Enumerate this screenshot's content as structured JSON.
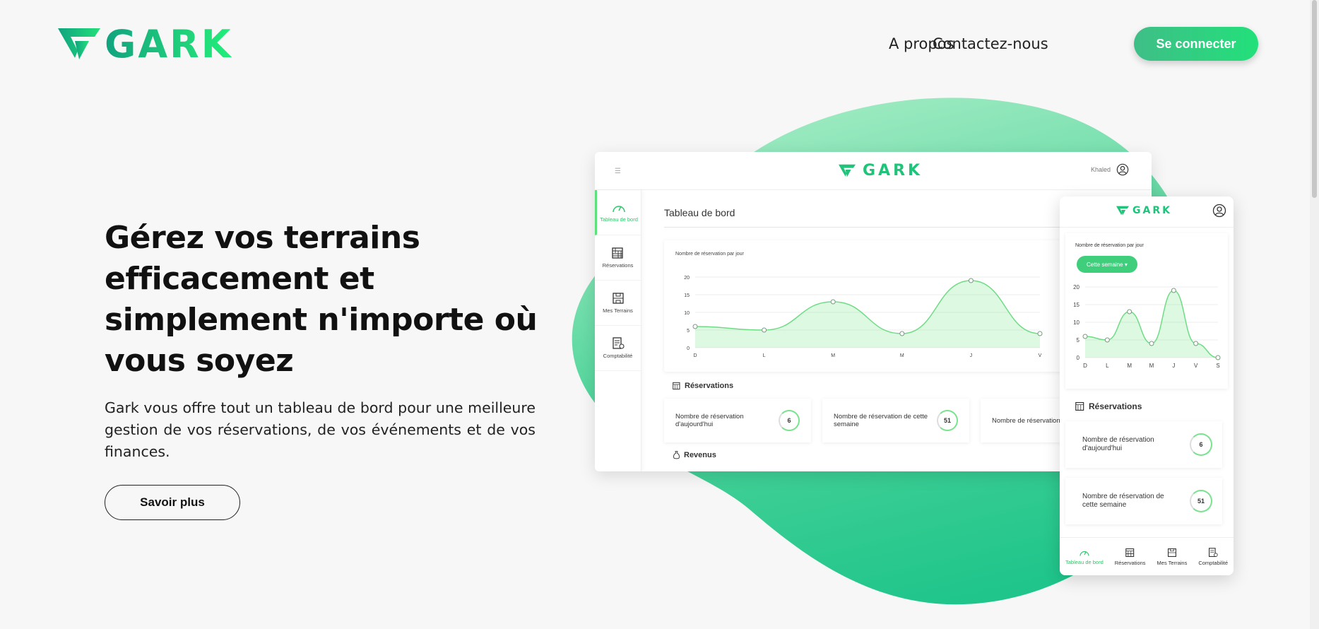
{
  "header": {
    "brand": "GARK",
    "nav": [
      {
        "label": "A propos"
      },
      {
        "label": "Contactez-nous"
      }
    ],
    "login_label": "Se connecter"
  },
  "hero": {
    "title": "Gérez vos terrains efficacement et simplement n'importe où vous soyez",
    "description": "Gark vous offre tout un tableau de bord pour une meilleure gestion de vos réservations, de vos événements et de vos finances.",
    "cta_label": "Savoir plus"
  },
  "desktop_mock": {
    "brand": "GARK",
    "user": "Khaled",
    "sidebar": [
      {
        "label": "Tableau de bord"
      },
      {
        "label": "Réservations"
      },
      {
        "label": "Mes Terrains"
      },
      {
        "label": "Comptabilité"
      }
    ],
    "page_title": "Tableau de bord",
    "chart_title": "Nombre de réservation par jour",
    "reservations_heading": "Réservations",
    "stats": [
      {
        "label": "Nombre de réservation d'aujourd'hui",
        "value": "6"
      },
      {
        "label": "Nombre de réservation de cette semaine",
        "value": "51"
      },
      {
        "label": "Nombre de réservation",
        "value": ""
      }
    ],
    "revenus_heading": "Revenus"
  },
  "mobile_mock": {
    "brand": "GARK",
    "chart_title": "Nombre de réservation par jour",
    "period_label": "Cette semaine",
    "reservations_heading": "Réservations",
    "stats": [
      {
        "label": "Nombre de réservation d'aujourd'hui",
        "value": "6"
      },
      {
        "label": "Nombre de réservation de cette semaine",
        "value": "51"
      }
    ],
    "nav": [
      {
        "label": "Tableau de bord"
      },
      {
        "label": "Réservations"
      },
      {
        "label": "Mes Terrains"
      },
      {
        "label": "Comptabilité"
      }
    ]
  },
  "chart_data": [
    {
      "type": "area",
      "title": "Nombre de réservation par jour",
      "categories": [
        "D",
        "L",
        "M",
        "M",
        "J",
        "V"
      ],
      "values": [
        6,
        5,
        13,
        4,
        19,
        4
      ],
      "ylim": [
        0,
        20
      ],
      "yticks": [
        0,
        5,
        10,
        15,
        20
      ]
    },
    {
      "type": "area",
      "title": "Nombre de réservation par jour",
      "categories": [
        "D",
        "L",
        "M",
        "M",
        "J",
        "V",
        "S"
      ],
      "values": [
        6,
        5,
        13,
        4,
        19,
        4,
        0
      ],
      "ylim": [
        0,
        20
      ],
      "yticks": [
        0,
        5,
        10,
        15,
        20
      ]
    }
  ],
  "colors": {
    "accent": "#22d67a",
    "accent_dark": "#10a37f"
  }
}
